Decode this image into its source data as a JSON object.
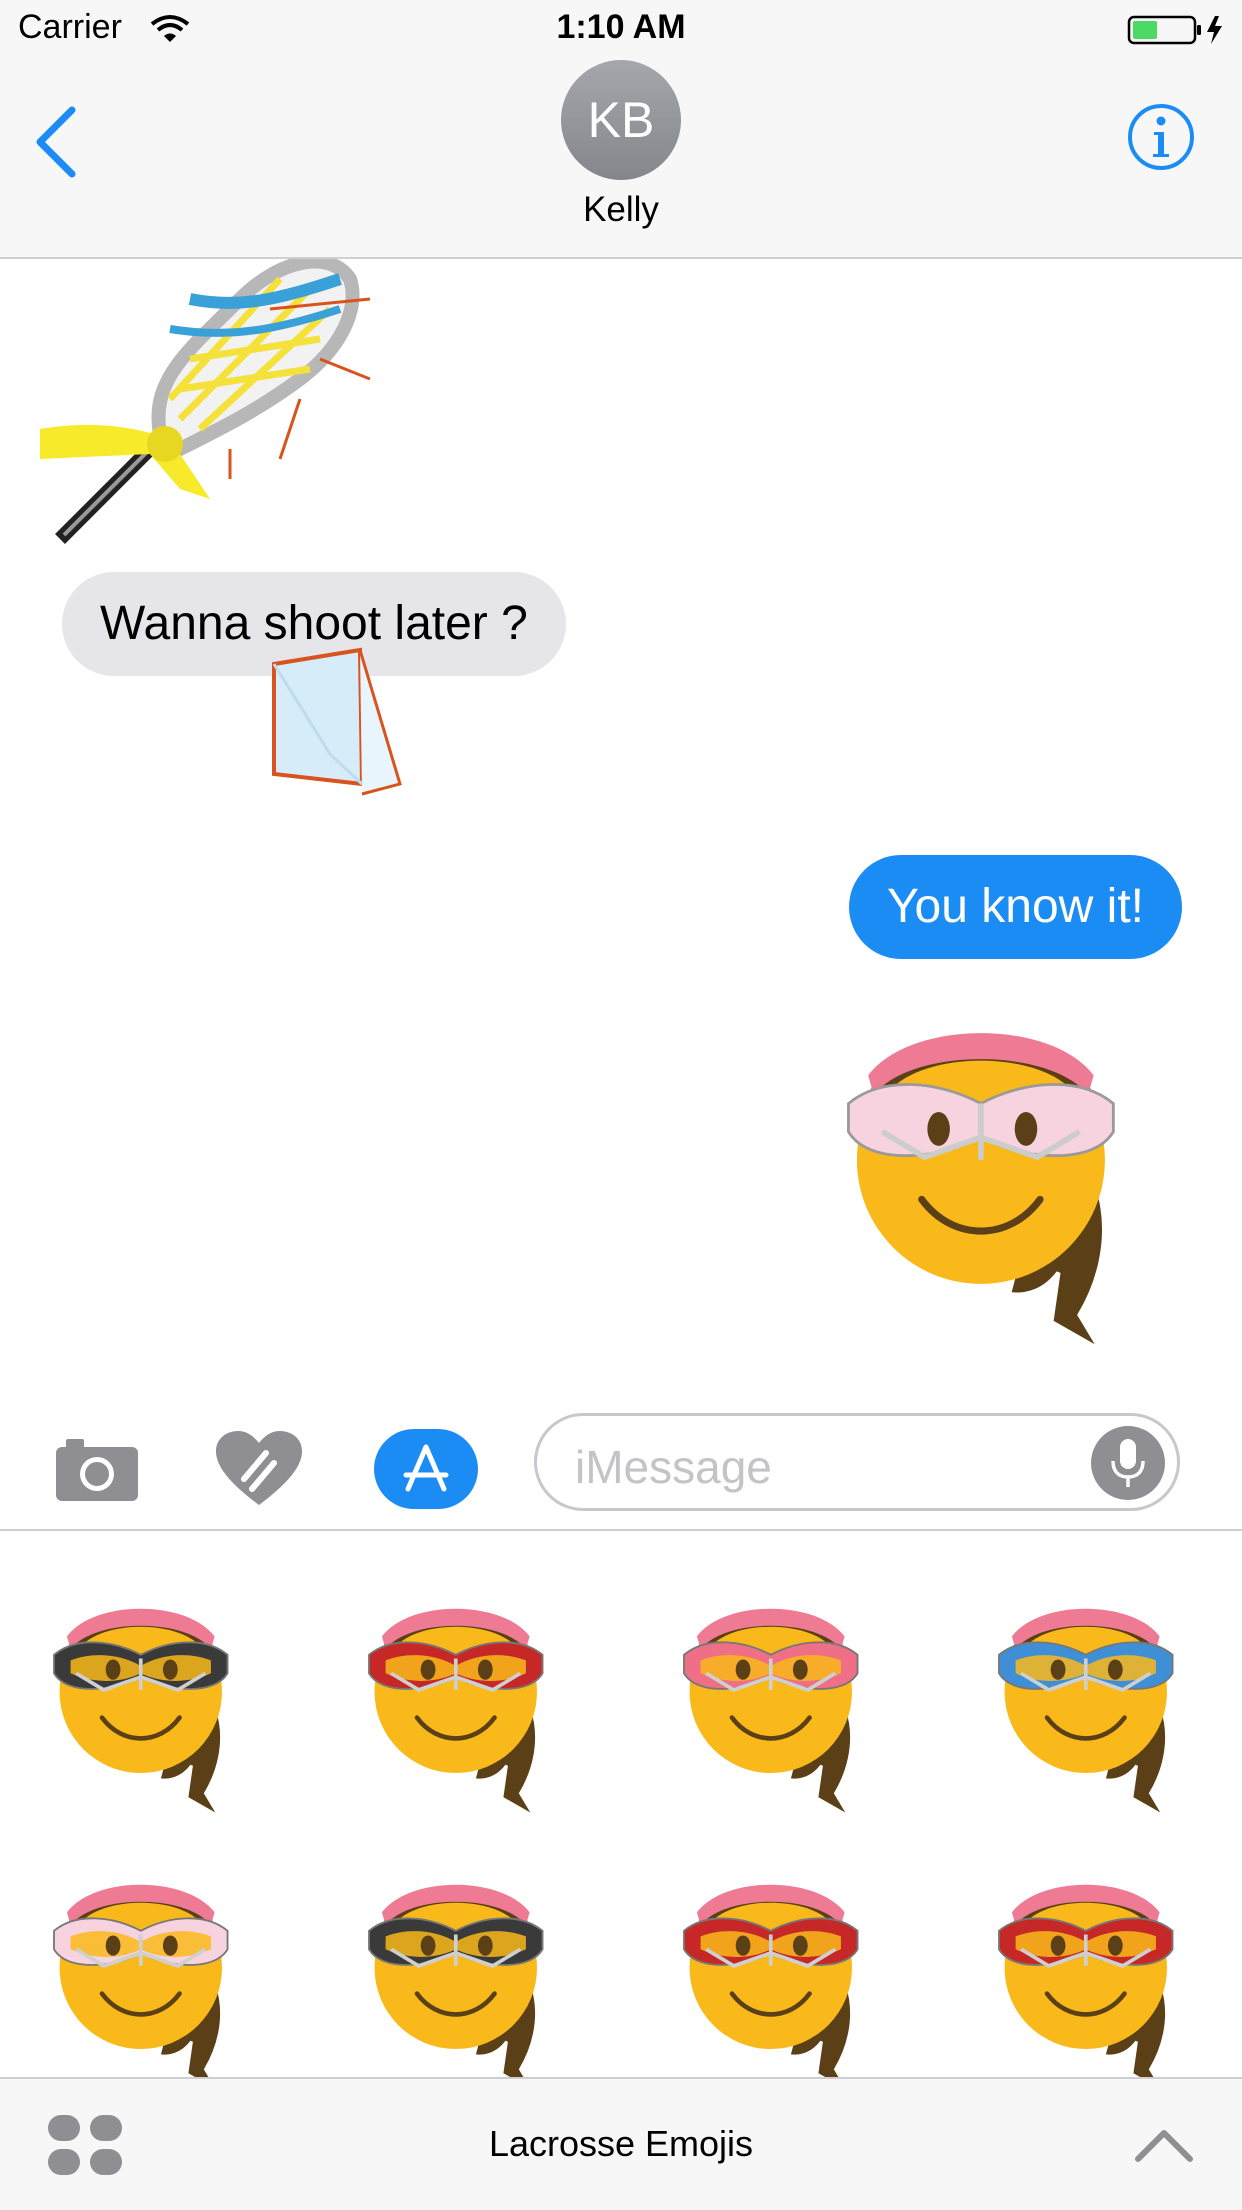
{
  "status_bar": {
    "carrier": "Carrier",
    "time": "1:10 AM"
  },
  "nav": {
    "avatar_initials": "KB",
    "contact_name": "Kelly"
  },
  "messages": [
    {
      "direction": "incoming",
      "text": "Wanna shoot later ?"
    },
    {
      "direction": "outgoing",
      "text": "You know it!"
    }
  ],
  "input": {
    "placeholder": "iMessage"
  },
  "drawer": {
    "app_name": "Lacrosse Emojis",
    "stickers": [
      {
        "name": "sticker-girl-black-goggles",
        "goggle_color": "#3a3a3a"
      },
      {
        "name": "sticker-girl-red-goggles",
        "goggle_color": "#c62828"
      },
      {
        "name": "sticker-girl-pink-goggles",
        "goggle_color": "#ef6f86"
      },
      {
        "name": "sticker-girl-blue-goggles",
        "goggle_color": "#3f8fd6"
      },
      {
        "name": "sticker-girl-lightpink-goggles",
        "goggle_color": "#f7d3df"
      },
      {
        "name": "sticker-girl-black-goggles",
        "goggle_color": "#3a3a3a"
      },
      {
        "name": "sticker-girl-red-goggles",
        "goggle_color": "#c62828"
      },
      {
        "name": "sticker-girl-red-goggles",
        "goggle_color": "#c62828"
      }
    ]
  },
  "colors": {
    "accent": "#1c8cf5",
    "incoming_bubble": "#e5e5ea",
    "face": "#f9b91a",
    "hair": "#5b3f17",
    "headband": "#ee7a93"
  }
}
